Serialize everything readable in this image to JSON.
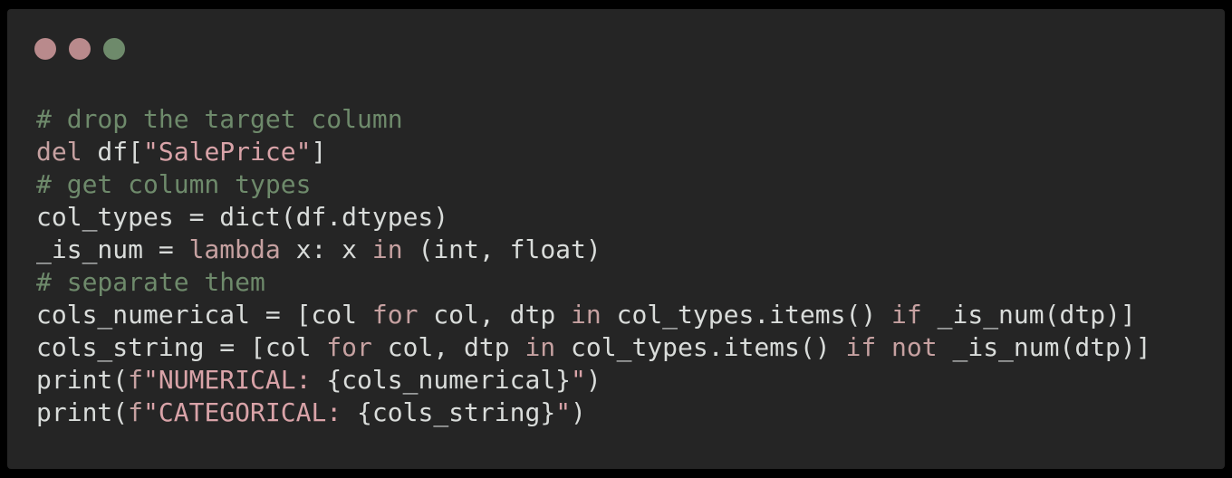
{
  "window": {
    "buttons": [
      {
        "name": "close",
        "color": "#b98a8c"
      },
      {
        "name": "minimize",
        "color": "#b98a8c"
      },
      {
        "name": "zoom",
        "color": "#6e8a6b"
      }
    ]
  },
  "colors": {
    "background": "#252525",
    "comment": "#6e8a6b",
    "keyword": "#c6a1a1",
    "string": "#d9a3a8",
    "text": "#d9dcda"
  },
  "code": {
    "language": "python",
    "lines": [
      [
        {
          "t": "comment",
          "v": "# drop the target column"
        }
      ],
      [
        {
          "t": "kw",
          "v": "del"
        },
        {
          "t": "plain",
          "v": " df["
        },
        {
          "t": "str",
          "v": "\"SalePrice\""
        },
        {
          "t": "plain",
          "v": "]"
        }
      ],
      [
        {
          "t": "comment",
          "v": "# get column types"
        }
      ],
      [
        {
          "t": "plain",
          "v": "col_types = dict(df.dtypes)"
        }
      ],
      [
        {
          "t": "plain",
          "v": "_is_num = "
        },
        {
          "t": "kw",
          "v": "lambda"
        },
        {
          "t": "plain",
          "v": " x: x "
        },
        {
          "t": "kw",
          "v": "in"
        },
        {
          "t": "plain",
          "v": " (int, float)"
        }
      ],
      [
        {
          "t": "comment",
          "v": "# separate them"
        }
      ],
      [
        {
          "t": "plain",
          "v": "cols_numerical = [col "
        },
        {
          "t": "kw",
          "v": "for"
        },
        {
          "t": "plain",
          "v": " col, dtp "
        },
        {
          "t": "kw",
          "v": "in"
        },
        {
          "t": "plain",
          "v": " col_types.items() "
        },
        {
          "t": "kw",
          "v": "if"
        },
        {
          "t": "plain",
          "v": " _is_num(dtp)]"
        }
      ],
      [
        {
          "t": "plain",
          "v": "cols_string = [col "
        },
        {
          "t": "kw",
          "v": "for"
        },
        {
          "t": "plain",
          "v": " col, dtp "
        },
        {
          "t": "kw",
          "v": "in"
        },
        {
          "t": "plain",
          "v": " col_types.items() "
        },
        {
          "t": "kw",
          "v": "if"
        },
        {
          "t": "plain",
          "v": " "
        },
        {
          "t": "kw",
          "v": "not"
        },
        {
          "t": "plain",
          "v": " _is_num(dtp)]"
        }
      ],
      [
        {
          "t": "plain",
          "v": "print("
        },
        {
          "t": "prefix",
          "v": "f"
        },
        {
          "t": "str",
          "v": "\"NUMERICAL: "
        },
        {
          "t": "plain",
          "v": "{cols_numerical}"
        },
        {
          "t": "str",
          "v": "\""
        },
        {
          "t": "plain",
          "v": ")"
        }
      ],
      [
        {
          "t": "plain",
          "v": "print("
        },
        {
          "t": "prefix",
          "v": "f"
        },
        {
          "t": "str",
          "v": "\"CATEGORICAL: "
        },
        {
          "t": "plain",
          "v": "{cols_string}"
        },
        {
          "t": "str",
          "v": "\""
        },
        {
          "t": "plain",
          "v": ")"
        }
      ]
    ]
  }
}
